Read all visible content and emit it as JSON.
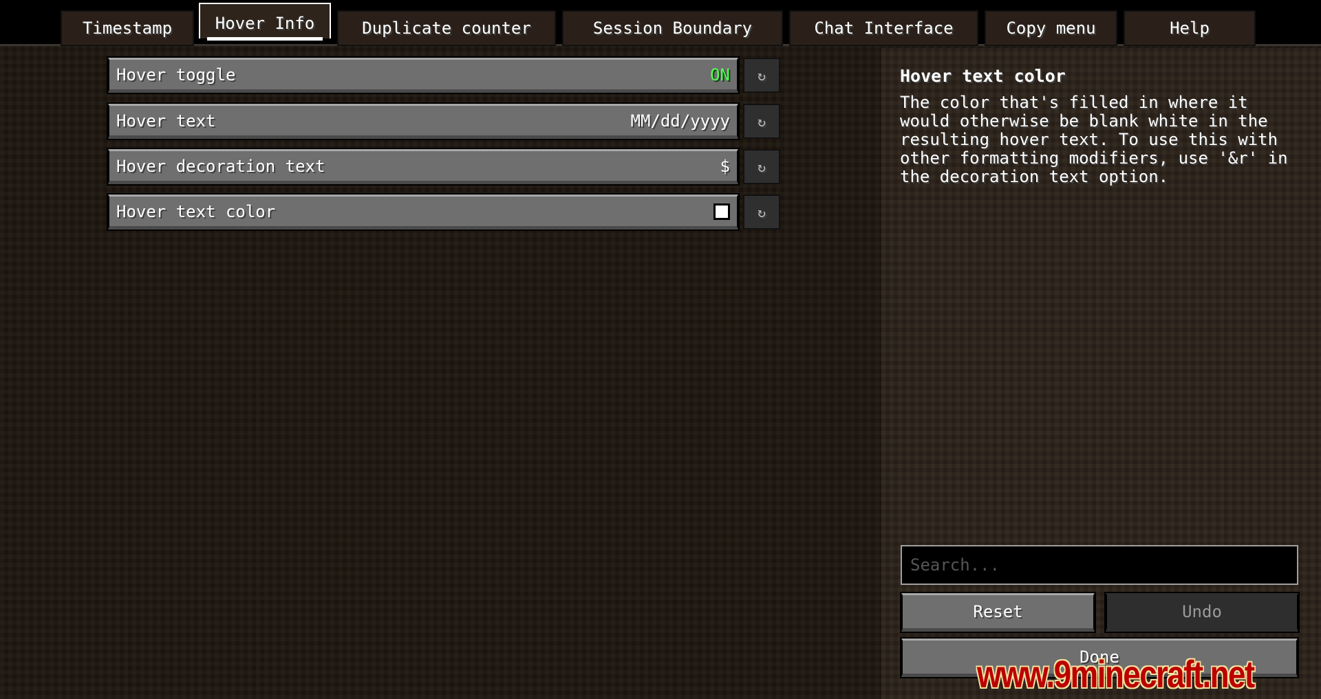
{
  "tabs": [
    {
      "label": "Timestamp"
    },
    {
      "label": "Hover Info",
      "selected": true
    },
    {
      "label": "Duplicate counter"
    },
    {
      "label": "Session Boundary"
    },
    {
      "label": "Chat Interface"
    },
    {
      "label": "Copy menu"
    },
    {
      "label": "Help"
    }
  ],
  "options": [
    {
      "label": "Hover toggle",
      "value": "ON",
      "value_color": "#55ff55"
    },
    {
      "label": "Hover text",
      "value": "MM/dd/yyyy"
    },
    {
      "label": "Hover decoration text",
      "value": "$"
    },
    {
      "label": "Hover text color",
      "value_swatch": "#ffffff"
    }
  ],
  "reset_icon": "reset-arrow-icon",
  "info": {
    "title": "Hover text color",
    "description_lines": [
      "The color that's filled in where it",
      "would otherwise be blank white in the",
      "resulting hover text. To use this with",
      "other formatting modifiers, use '&r' in",
      "the decoration text option."
    ]
  },
  "search": {
    "placeholder": "Search..."
  },
  "buttons": {
    "reset": "Reset",
    "undo": "Undo",
    "done": "Done"
  },
  "watermark": "www.9minecraft.net"
}
